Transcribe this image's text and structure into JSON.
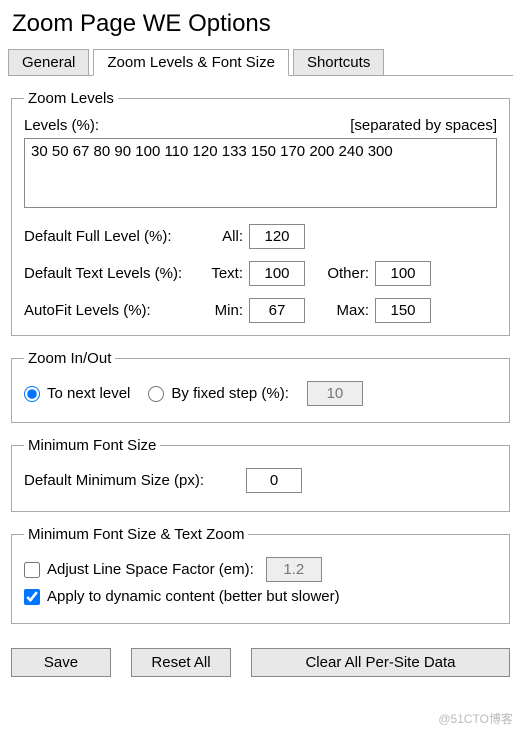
{
  "title": "Zoom Page WE Options",
  "tabs": {
    "general": "General",
    "zoom_levels": "Zoom Levels & Font Size",
    "shortcuts": "Shortcuts",
    "active": "zoom_levels"
  },
  "zoom_levels": {
    "legend": "Zoom Levels",
    "levels_label": "Levels (%):",
    "levels_hint": "[separated by spaces]",
    "levels_value": "30 50 67 80 90 100 110 120 133 150 170 200 240 300",
    "default_full_label": "Default Full Level (%):",
    "all_label": "All:",
    "all_value": "120",
    "default_text_label": "Default Text Levels (%):",
    "text_label": "Text:",
    "text_value": "100",
    "other_label": "Other:",
    "other_value": "100",
    "autofit_label": "AutoFit Levels (%):",
    "min_label": "Min:",
    "min_value": "67",
    "max_label": "Max:",
    "max_value": "150"
  },
  "zoom_inout": {
    "legend": "Zoom In/Out",
    "to_next_label": "To next level",
    "by_fixed_label": "By fixed step (%):",
    "by_fixed_value": "10",
    "selected": "to_next"
  },
  "min_font_size": {
    "legend": "Minimum Font Size",
    "default_label": "Default Minimum Size (px):",
    "default_value": "0"
  },
  "min_font_text_zoom": {
    "legend": "Minimum Font Size & Text Zoom",
    "adjust_label": "Adjust Line Space Factor (em):",
    "adjust_value": "1.2",
    "adjust_checked": false,
    "dynamic_label": "Apply to dynamic content (better but slower)",
    "dynamic_checked": true
  },
  "buttons": {
    "save": "Save",
    "reset": "Reset All",
    "clear": "Clear All Per-Site Data"
  },
  "watermark": "@51CTO博客"
}
